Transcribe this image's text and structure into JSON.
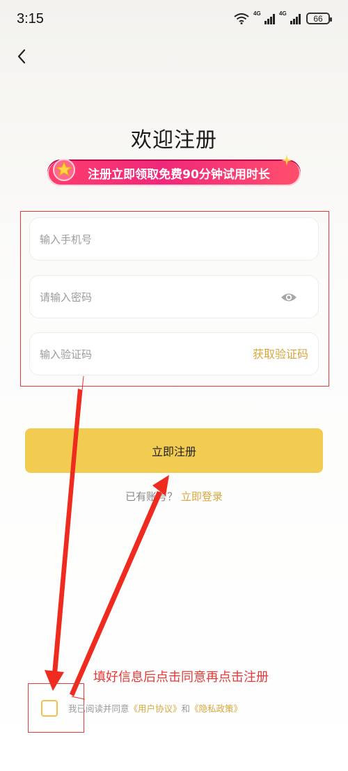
{
  "status_bar": {
    "time": "3:15",
    "signal_label_1": "4G",
    "signal_label_2": "4G",
    "battery": "66"
  },
  "page": {
    "title": "欢迎注册",
    "promo_banner": "注册立即领取免费90分钟试用时长"
  },
  "form": {
    "phone_placeholder": "输入手机号",
    "password_placeholder": "请输入密码",
    "code_placeholder": "输入验证码",
    "get_code_label": "获取验证码",
    "submit_label": "立即注册"
  },
  "login": {
    "prompt": "已有账号？",
    "link": "立即登录"
  },
  "agreement": {
    "prefix": "我已阅读并同意",
    "user_agreement": "《用户协议》",
    "and": "和",
    "privacy_policy": "《隐私政策》",
    "checked": false
  },
  "annotation": {
    "text": "填好信息后点击同意再点击注册"
  },
  "colors": {
    "accent": "#f2cc50",
    "link": "#d9a63e",
    "annotation": "#e53935",
    "promo": "#f0287a"
  },
  "icons": [
    "wifi-icon",
    "signal-icon",
    "battery-icon",
    "back-arrow-icon",
    "eye-icon",
    "gift-badge-icon",
    "sparkle-icon"
  ]
}
